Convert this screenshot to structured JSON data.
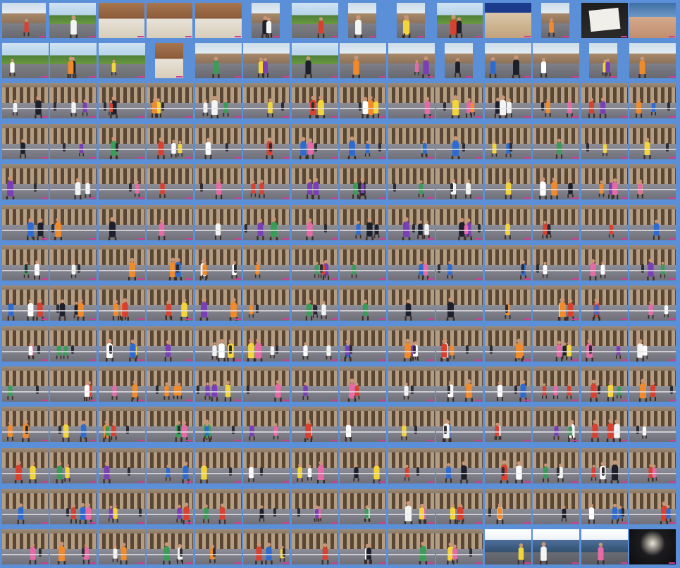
{
  "gallery": {
    "columns": 14,
    "rows": 14,
    "background": "#5b8fd8",
    "accent_badge": "#d23c9b"
  },
  "scenes": {
    "row_0": [
      "street",
      "street",
      "park",
      "indoor",
      "indoor",
      "indoor",
      "street",
      "park",
      "street",
      "street",
      "park",
      "banner",
      "street",
      "sign",
      "face"
    ],
    "row_1": [
      "park",
      "park",
      "park",
      "indoor",
      "street",
      "street",
      "park",
      "street",
      "street",
      "street",
      "street",
      "street",
      "street",
      "street",
      "street"
    ],
    "last_row_tail": [
      "tent",
      "tent",
      "tent",
      "night"
    ]
  },
  "runner_colors": [
    "#f4f4f2",
    "#d8412f",
    "#1d1f2b",
    "#2e6bd1",
    "#f3d43a",
    "#e56aa6",
    "#3b9c57",
    "#f08a2a",
    "#7a3fb5",
    "#ffffff"
  ]
}
